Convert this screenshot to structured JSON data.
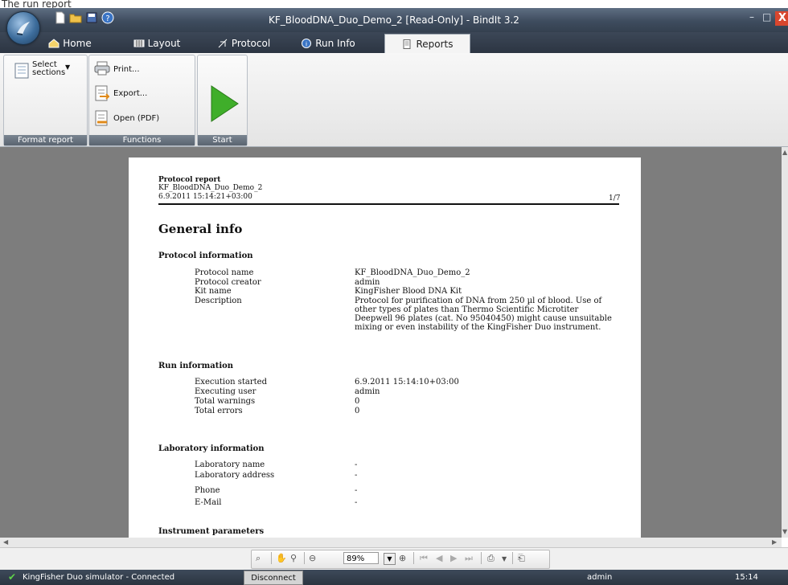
{
  "caption": "The run report",
  "window": {
    "title": "KF_BloodDNA_Duo_Demo_2 [Read-Only] - BindIt 3.2",
    "minimize": "–",
    "maximize": "□",
    "close": "X"
  },
  "tabs": [
    "Home",
    "Layout",
    "Protocol",
    "Run Info",
    "Reports"
  ],
  "ribbon": {
    "select_sections": "Select sections",
    "print": "Print...",
    "export": "Export...",
    "open_pdf": "Open (PDF)",
    "group_format": "Format report",
    "group_functions": "Functions",
    "group_start": "Start"
  },
  "report": {
    "header_title": "Protocol report",
    "header_name": "KF_BloodDNA_Duo_Demo_2",
    "header_date": "6.9.2011 15:14:21+03:00",
    "page_indicator": "1/7",
    "section_title": "General info",
    "protocol_info": {
      "heading": "Protocol information",
      "rows": [
        {
          "label": "Protocol name",
          "value": "KF_BloodDNA_Duo_Demo_2"
        },
        {
          "label": "Protocol creator",
          "value": "admin"
        },
        {
          "label": "Kit name",
          "value": "KingFisher Blood DNA Kit"
        },
        {
          "label": "Description",
          "value": "Protocol for purification of DNA from 250 µl of blood. Use of other types of plates than Thermo Scientific Microtiter Deepwell 96 plates (cat. No 95040450) might cause unsuitable mixing or even instability of the KingFisher Duo instrument."
        }
      ]
    },
    "run_info": {
      "heading": "Run information",
      "rows": [
        {
          "label": "Execution started",
          "value": "6.9.2011 15:14:10+03:00"
        },
        {
          "label": "Executing user",
          "value": "admin"
        },
        {
          "label": "Total warnings",
          "value": "0"
        },
        {
          "label": "Total errors",
          "value": "0"
        }
      ]
    },
    "lab_info": {
      "heading": "Laboratory information",
      "rows": [
        {
          "label": "Laboratory name",
          "value": "-"
        },
        {
          "label": "Laboratory address",
          "value": "-"
        },
        {
          "label": "Phone",
          "value": "-"
        },
        {
          "label": "E-Mail",
          "value": "-"
        }
      ]
    },
    "instrument_heading": "Instrument parameters"
  },
  "toolbar": {
    "zoom": "89%"
  },
  "status": {
    "connection": "KingFisher Duo simulator - Connected",
    "disconnect": "Disconnect",
    "user": "admin",
    "time": "15:14"
  },
  "colors": {
    "start_green": "#3fae2a",
    "status_check": "#5fd24a",
    "close_red": "#d8462e"
  }
}
